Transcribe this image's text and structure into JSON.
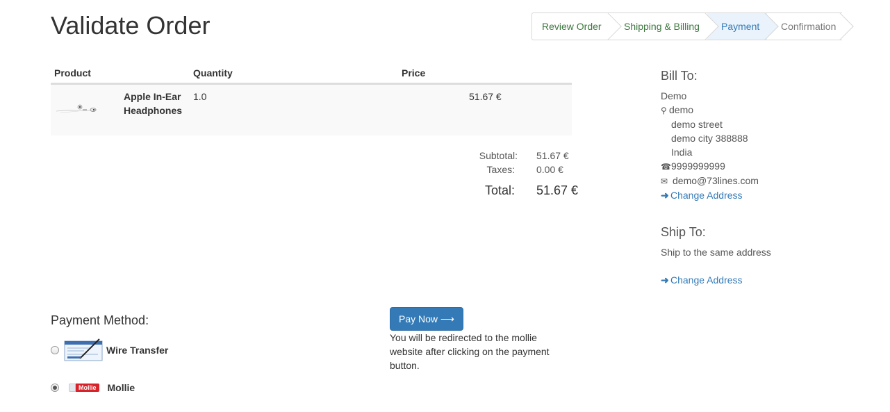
{
  "page_title": "Validate Order",
  "wizard": {
    "steps": [
      {
        "label": "Review Order",
        "state": "done"
      },
      {
        "label": "Shipping & Billing",
        "state": "done"
      },
      {
        "label": "Payment",
        "state": "active"
      },
      {
        "label": "Confirmation",
        "state": "todo"
      }
    ]
  },
  "cart": {
    "headers": {
      "product": "Product",
      "quantity": "Quantity",
      "price": "Price"
    },
    "lines": [
      {
        "image_icon": "headphones-icon",
        "product": "Apple In-Ear Headphones",
        "quantity": "1.0",
        "price": "51.67 €"
      }
    ],
    "subtotal_label": "Subtotal:",
    "subtotal_value": "51.67 €",
    "taxes_label": "Taxes:",
    "taxes_value": "0.00 €",
    "total_label": "Total:",
    "total_value": "51.67 €"
  },
  "bill_to": {
    "heading": "Bill To:",
    "name": "Demo",
    "contact": "demo",
    "street": "demo street",
    "city_zip": "demo city 388888",
    "country": "India",
    "phone": "9999999999",
    "email": "demo@73lines.com",
    "change_address": "Change Address"
  },
  "ship_to": {
    "heading": "Ship To:",
    "note": "Ship to the same address",
    "change_address": "Change Address"
  },
  "payment": {
    "heading": "Payment Method:",
    "methods": [
      {
        "label": "Wire Transfer",
        "icon": "wire-transfer-icon",
        "selected": false
      },
      {
        "label": "Mollie",
        "icon": "mollie-logo-icon",
        "logo_text": "Mollie",
        "selected": true
      }
    ],
    "pay_button": "Pay Now ⟶",
    "redirect_note": "You will be redirected to the mollie website after clicking on the payment button."
  },
  "colors": {
    "primary": "#337ab7",
    "success": "#3c763d",
    "active_step_bg": "#eaf3fb",
    "mollie_red": "#d9232a"
  }
}
